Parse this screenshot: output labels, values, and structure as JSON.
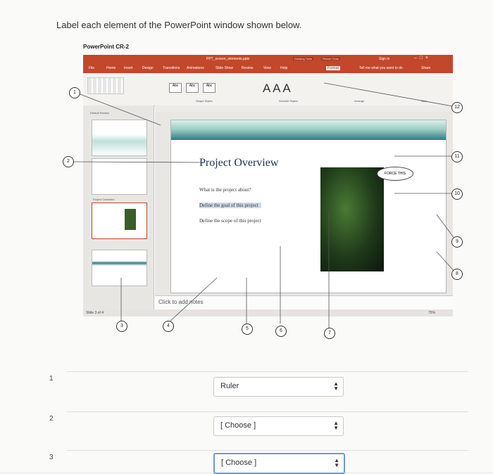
{
  "question": {
    "title": "Label each element of the PowerPoint window shown below."
  },
  "ppt": {
    "window_title": "PowerPoint CR-2",
    "file_name": "PPT_screen_elements.pptx",
    "tabs": [
      "File",
      "Home",
      "Insert",
      "Design",
      "Transitions",
      "Animations",
      "Slide Show",
      "Review",
      "View",
      "Help",
      "Format"
    ],
    "contextual": [
      "Drawing Tools",
      "Picture Tools"
    ],
    "tell_me": "Tell me what you want to do",
    "sign_in": "Sign in",
    "share": "Share",
    "slide_title": "Project Overview",
    "bullets": [
      "What is the project about?",
      "Define the goal of this project",
      "Define the scope of this project"
    ],
    "notes_placeholder": "Click to add notes",
    "status": "Slide 3 of 4",
    "section_label": "Default Section",
    "thumb_label": "Project Overview",
    "zoom": "75%",
    "bubble_text": "FORCE THIS",
    "ribbon_groups": [
      "Shape Styles",
      "WordArt Styles",
      "Arrange",
      "Size"
    ],
    "big_a": "A A A"
  },
  "callouts": [
    "1",
    "2",
    "3",
    "4",
    "5",
    "6",
    "7",
    "8",
    "9",
    "10",
    "11",
    "12"
  ],
  "rows": [
    {
      "num": "1",
      "value": "Ruler"
    },
    {
      "num": "2",
      "value": "[ Choose ]"
    },
    {
      "num": "3",
      "value": "[ Choose ]"
    }
  ]
}
